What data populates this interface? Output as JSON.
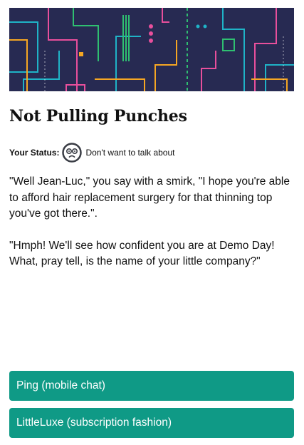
{
  "title": "Not Pulling Punches",
  "status": {
    "label": "Your Status:",
    "icon": "worried-face-icon",
    "value": "Don't want to talk about"
  },
  "story": [
    "\"Well Jean-Luc,\" you say with a smirk, \"I hope you're able to afford hair replacement surgery for that thinning top you've got there.\".",
    "\"Hmph! We'll see how confident you are at Demo Day! What, pray tell, is the name of your little company?\""
  ],
  "choices": [
    {
      "label": "Ping (mobile chat)"
    },
    {
      "label": "LittleLuxe (subscription fashion)"
    }
  ],
  "colors": {
    "banner_bg": "#272a52",
    "choice_bg": "#0f9a86",
    "accent_pink": "#e84f9c",
    "accent_teal": "#1fb3c7",
    "accent_green": "#2fbf71",
    "accent_orange": "#f5a623"
  }
}
